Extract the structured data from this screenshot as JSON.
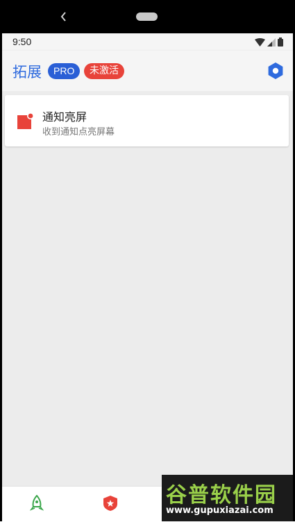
{
  "status_bar": {
    "time": "9:50"
  },
  "app_bar": {
    "title": "拓展",
    "pro_badge": "PRO",
    "inactive_badge": "未激活"
  },
  "extensions": [
    {
      "title": "通知亮屏",
      "subtitle": "收到通知点亮屏幕"
    }
  ],
  "bottom_nav": {
    "tabs": [
      {
        "icon": "rocket-icon"
      },
      {
        "icon": "shield-star-icon"
      },
      {
        "icon": "settings-icon"
      }
    ]
  },
  "watermark": {
    "brand": "谷普软件园",
    "url": "www.gupuxiazai.com"
  },
  "colors": {
    "accent": "#2f6bde",
    "pro_badge": "#2a5fd6",
    "inactive_badge": "#e8433a",
    "extension_icon": "#e8433a",
    "rocket": "#3aa64a",
    "content_bg": "#ececec"
  }
}
